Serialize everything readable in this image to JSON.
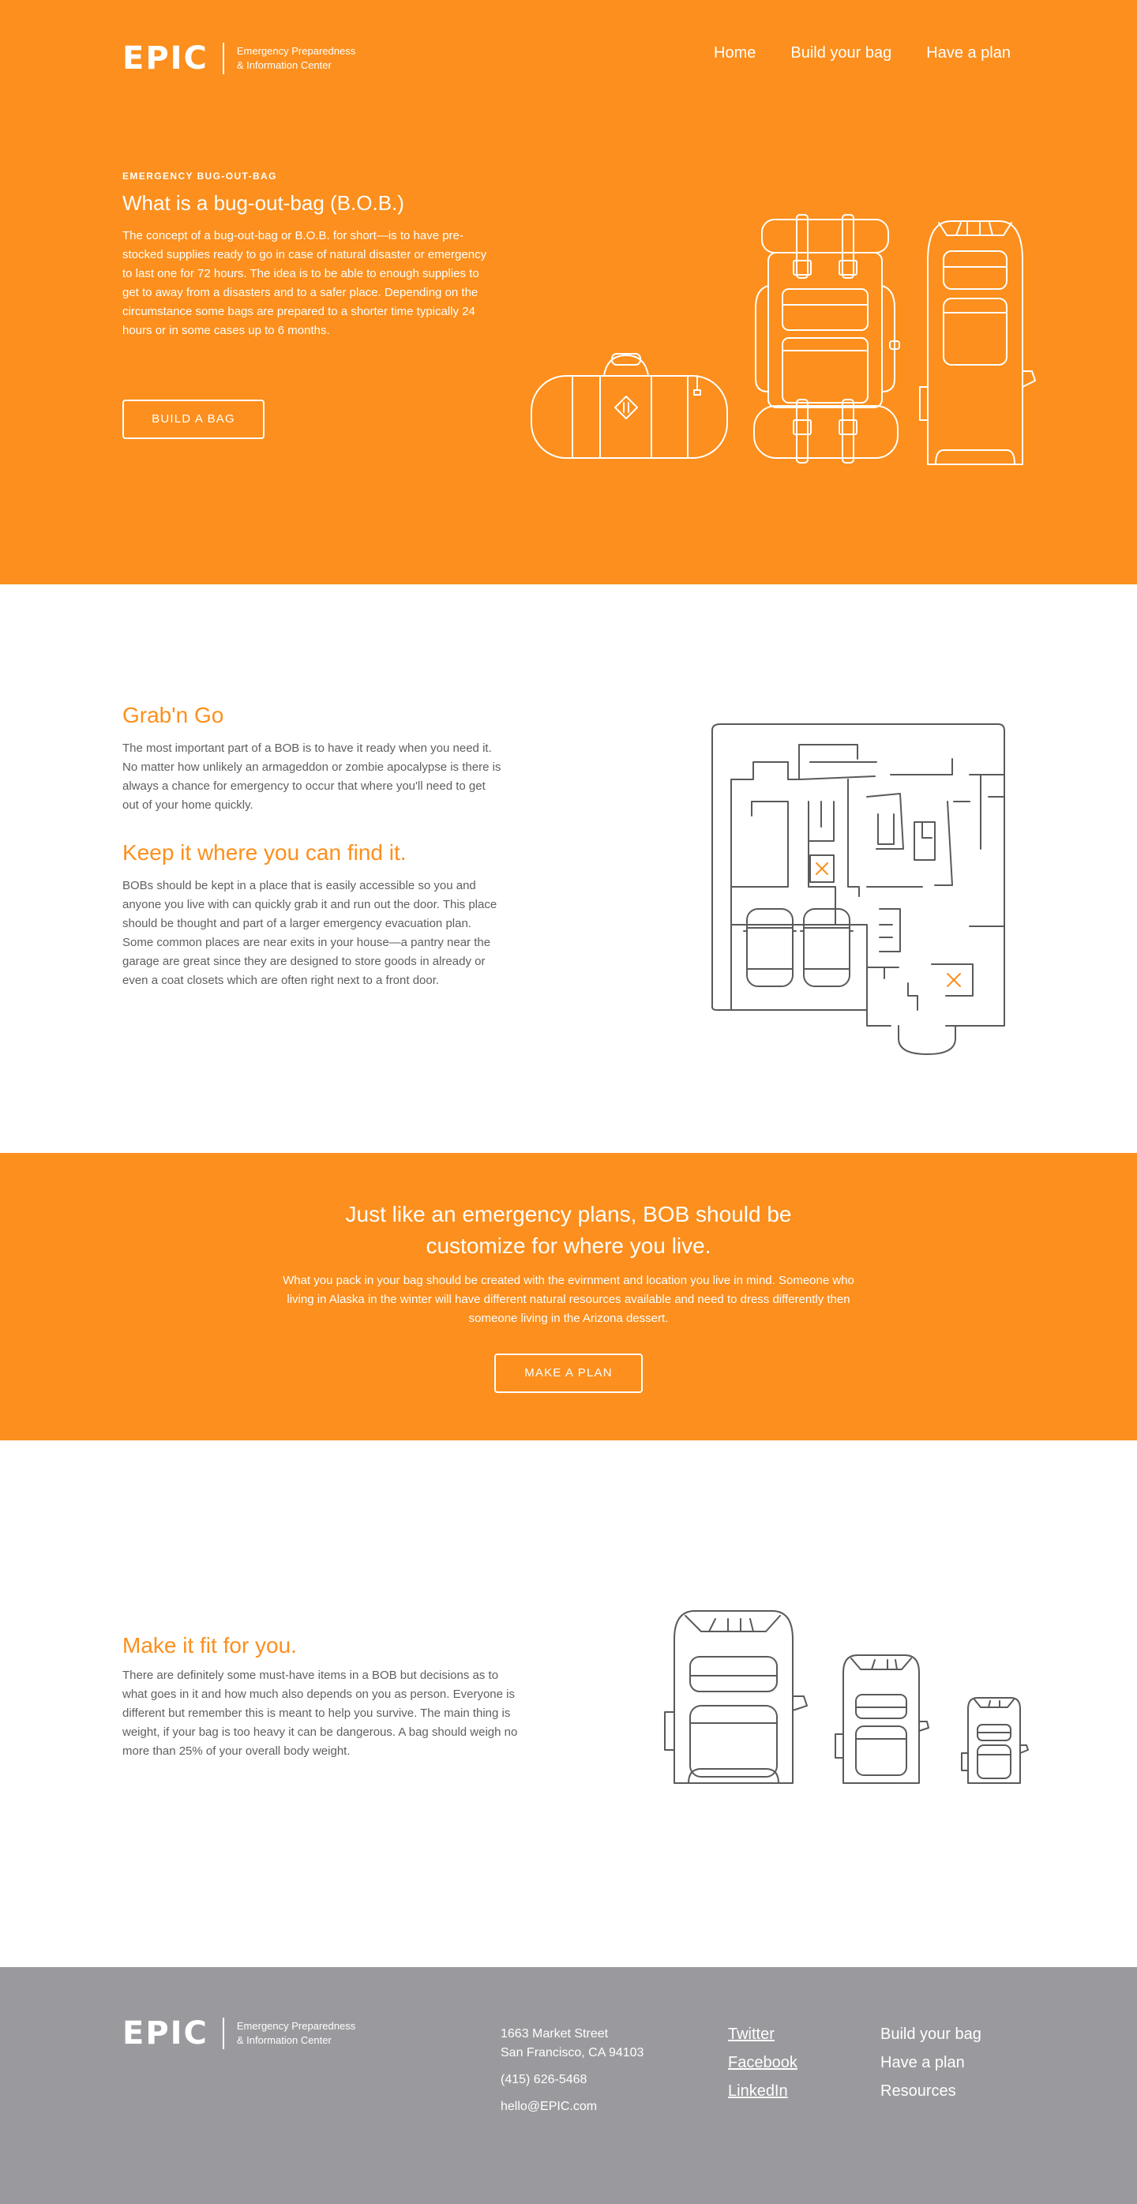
{
  "brand": {
    "logo_text": "EPIC",
    "subtitle_line1": "Emergency Preparedness",
    "subtitle_line2": "& Information Center"
  },
  "nav": {
    "items": [
      "Home",
      "Build your bag",
      "Have a plan"
    ]
  },
  "hero": {
    "eyebrow": "EMERGENCY BUG-OUT-BAG",
    "title": "What is a bug-out-bag (B.O.B.)",
    "body": "The concept of a bug-out-bag or B.O.B. for short—is to have pre-stocked supplies ready to go in case of natural disaster or emergency to last one for 72 hours. The idea is to be able to enough supplies to get to away from a disasters and to a safer place. Depending on the circumstance some bags are prepared to a shorter time typically 24 hours or in some cases up to 6 months.",
    "button_label": "BUILD A BAG"
  },
  "grab": {
    "heading": "Grab'n Go",
    "body": "The most important part of a BOB is to have it ready when you need it. No matter how unlikely an armageddon or zombie apocalypse is there is always a chance for emergency to occur that where you'll need to get out of your home quickly.",
    "heading2": "Keep it where you can find it.",
    "body2": "BOBs should be kept in a place that is easily accessible so you and anyone you live with can quickly grab it and run out the door. This place should be thought and part of a larger emergency evacuation plan. Some common places are near exits in your house—a pantry near the garage are great since they are designed to store goods in already or even a coat closets which are often right next to a front door."
  },
  "banner": {
    "heading": "Just like an emergency plans, BOB should be customize for where you live.",
    "body": "What you pack in your bag should be created with the evirnment and location you live in mind. Someone who living in Alaska in the winter will have different natural resources available and need to dress differently then someone living in the Arizona dessert.",
    "button_label": "MAKE A PLAN"
  },
  "fit": {
    "heading": "Make it fit for you.",
    "body": "There are definitely some must-have items in a BOB but decisions as to what goes in it and how much also depends on you as person. Everyone is different but remember this is meant to help you survive. The main thing is weight, if your bag is too heavy it can be dangerous. A bag should weigh no more than 25% of your overall body weight."
  },
  "footer": {
    "address_line1": "1663 Market Street",
    "address_line2": "San Francisco, CA 94103",
    "phone": "(415) 626-5468",
    "email": "hello@EPIC.com",
    "social": [
      "Twitter",
      "Facebook",
      "LinkedIn"
    ],
    "links": [
      "Build your bag",
      "Have a plan",
      "Resources"
    ]
  },
  "colors": {
    "accent": "#fc8f1d",
    "footer_bg": "#9a9a9e",
    "text": "#5f5f5f"
  },
  "icons": [
    "duffel-bag-icon",
    "frame-backpack-icon",
    "daypack-icon",
    "floor-plan-icon",
    "backpack-large-icon",
    "backpack-medium-icon",
    "backpack-small-icon"
  ]
}
